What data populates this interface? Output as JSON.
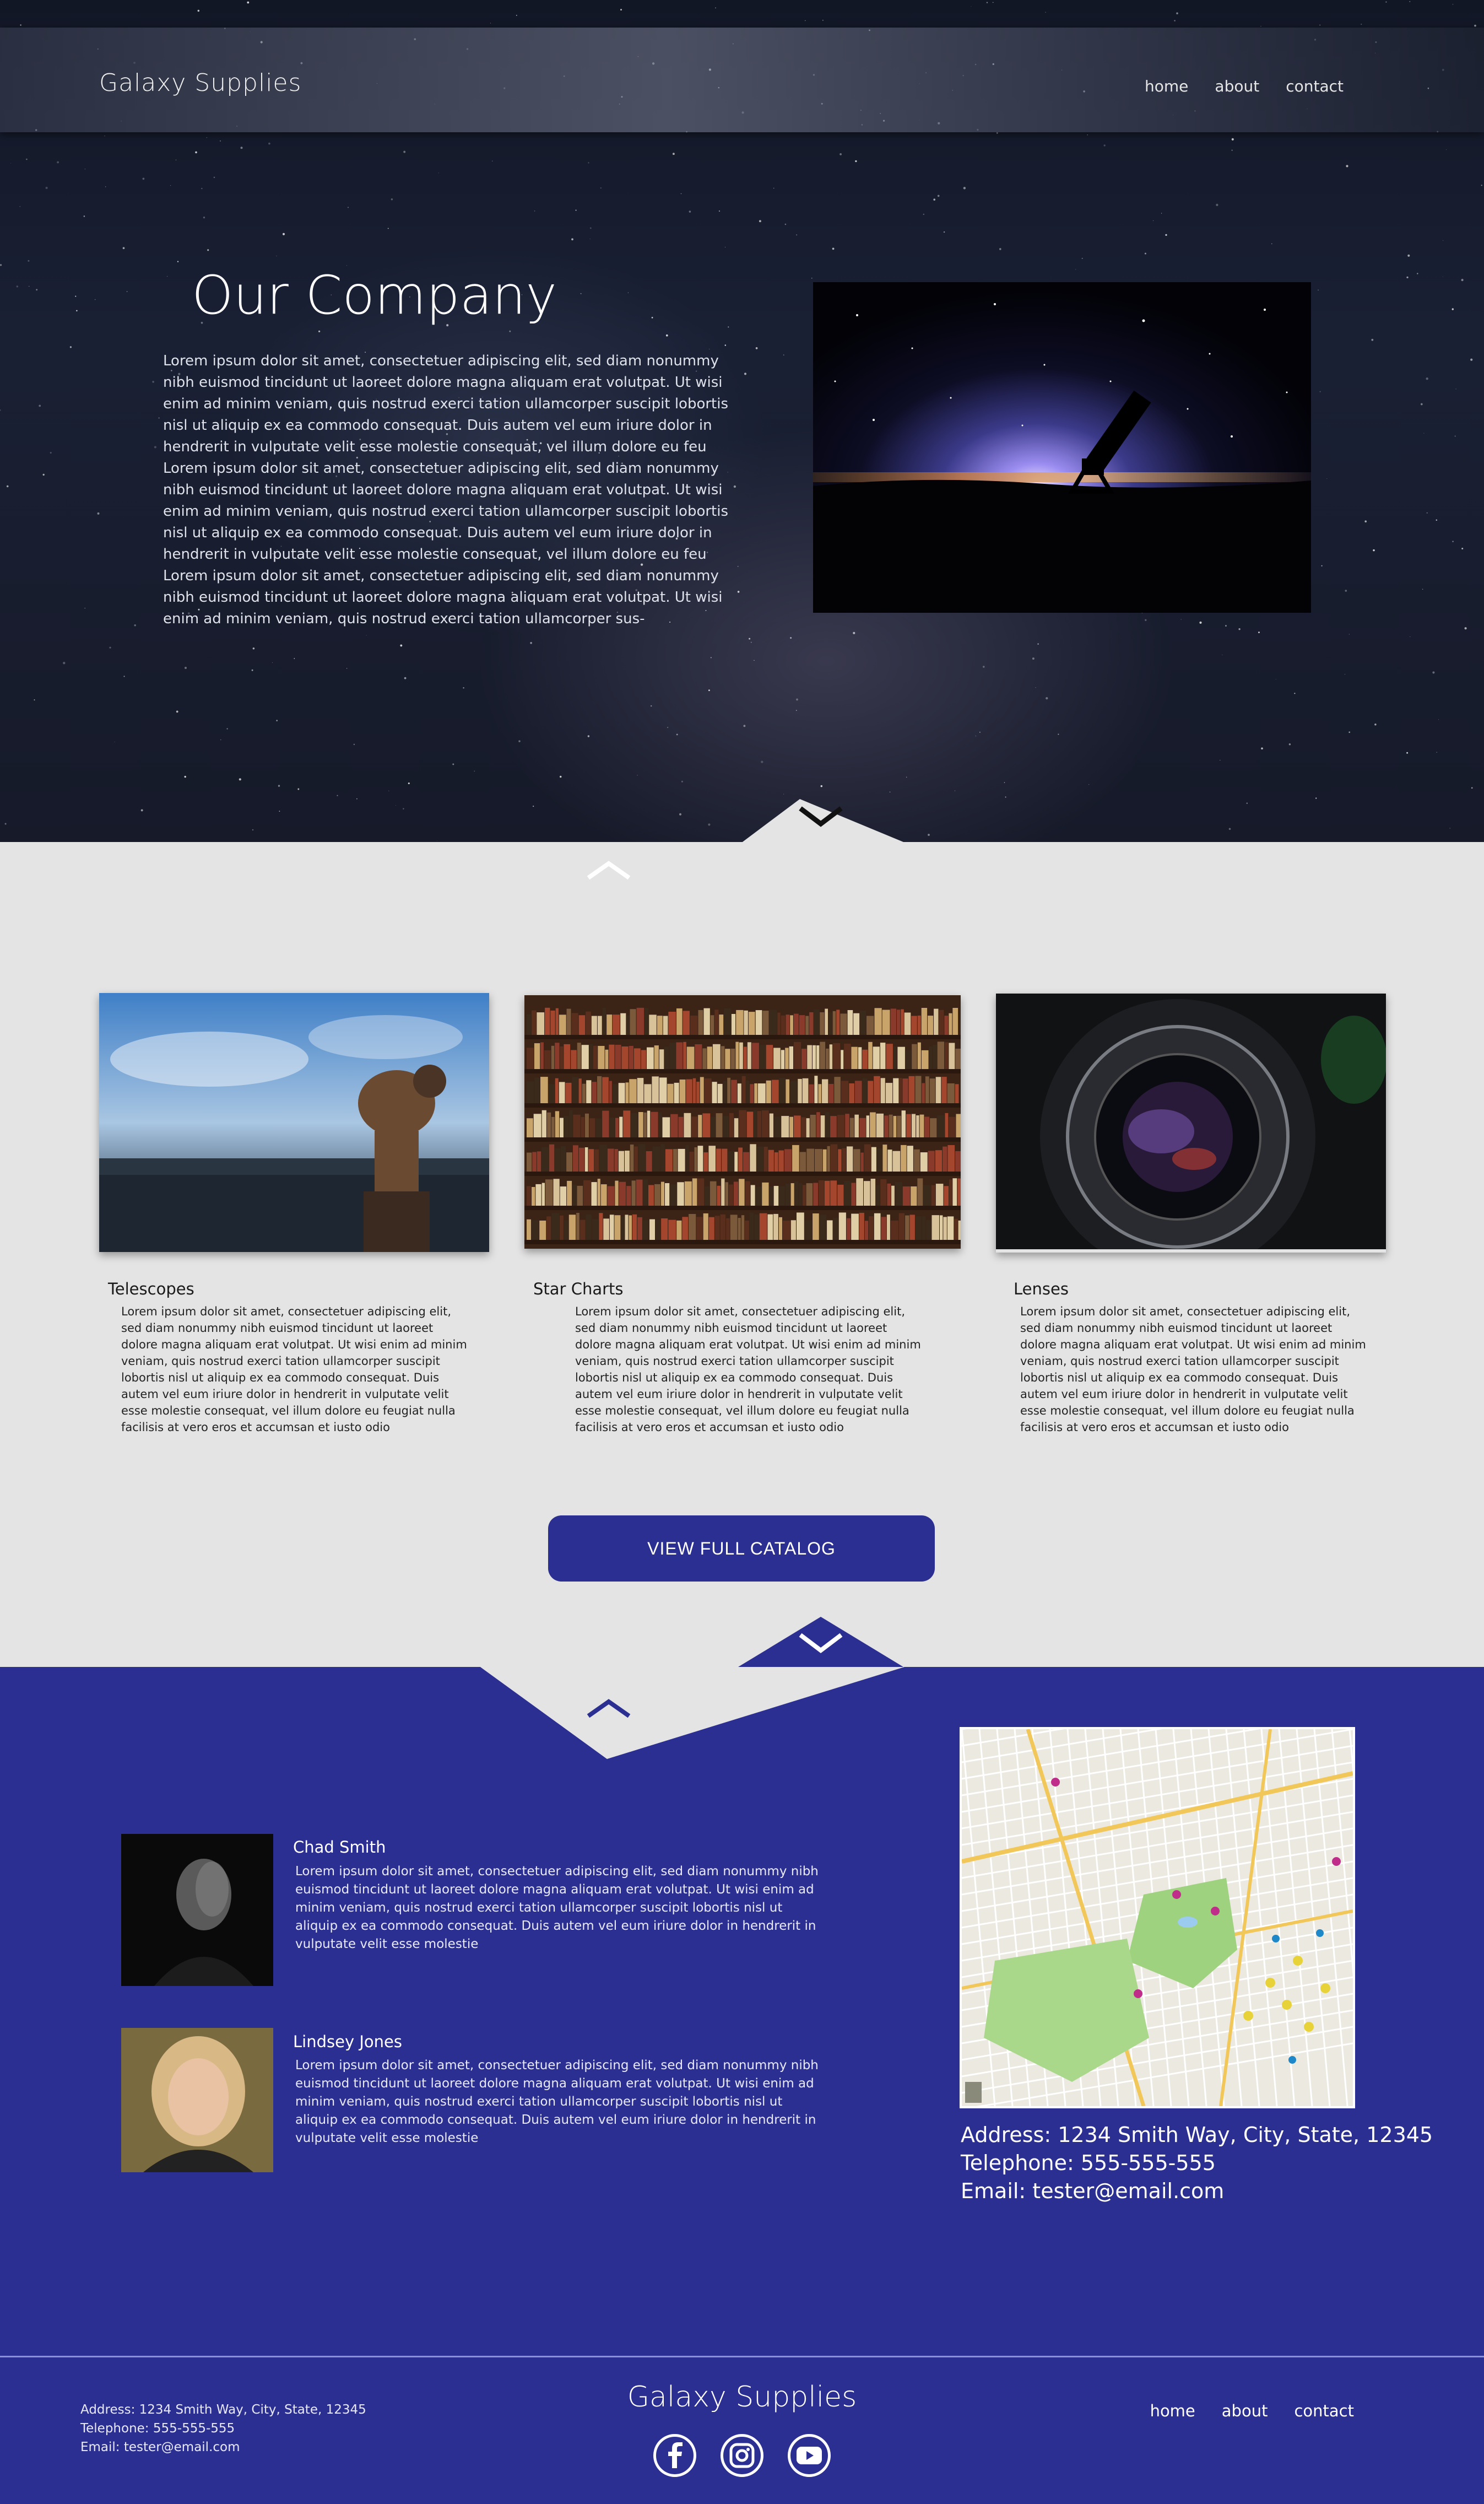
{
  "header": {
    "brand": "Galaxy Supplies",
    "nav": [
      "home",
      "about",
      "contact"
    ]
  },
  "hero": {
    "title": "Our Company",
    "text": "Lorem ipsum dolor sit amet, consectetuer adipiscing elit, sed diam nonummy nibh euismod tincidunt ut laoreet dolore magna aliquam erat volutpat. Ut wisi enim ad minim veniam, quis nostrud exerci tation ullamcorper suscipit lobortis nisl ut aliquip ex ea commodo consequat. Duis autem vel eum iriure dolor in hendrerit in vulputate velit esse molestie consequat, vel illum dolore eu feu Lorem ipsum dolor sit amet, consectetuer adipiscing elit, sed diam nonummy nibh euismod tincidunt ut laoreet dolore magna aliquam erat volutpat. Ut wisi enim ad minim veniam, quis nostrud exerci tation ullamcorper suscipit lobortis nisl ut aliquip ex ea commodo consequat. Duis autem vel eum iriure dolor in hendrerit in vulputate velit esse molestie consequat, vel illum dolore eu feu Lorem ipsum dolor sit amet, consectetuer adipiscing elit, sed diam nonummy nibh euismod tincidunt ut laoreet dolore magna aliquam erat volutpat. Ut wisi enim ad minim veniam, quis nostrud exerci tation ullamcorper sus-"
  },
  "products": [
    {
      "title": "Telescopes",
      "text": "Lorem ipsum dolor sit amet, consectetuer adipiscing elit, sed diam nonummy nibh euismod tincidunt ut laoreet dolore magna aliquam erat volutpat. Ut wisi enim ad minim veniam, quis nostrud exerci tation ullamcorper suscipit lobortis nisl ut aliquip ex ea commodo consequat. Duis autem vel eum iriure dolor in hendrerit in vulputate velit esse molestie consequat, vel illum dolore eu feugiat nulla facilisis at vero eros et accumsan et iusto odio"
    },
    {
      "title": "Star Charts",
      "text": "Lorem ipsum dolor sit amet, consectetuer adipiscing elit, sed diam nonummy nibh euismod tincidunt ut laoreet dolore magna aliquam erat volutpat. Ut wisi enim ad minim veniam, quis nostrud exerci tation ullamcorper suscipit lobortis nisl ut aliquip ex ea commodo consequat. Duis autem vel eum iriure dolor in hendrerit in vulputate velit esse molestie consequat, vel illum dolore eu feugiat nulla facilisis at vero eros et accumsan et iusto odio"
    },
    {
      "title": "Lenses",
      "text": "Lorem ipsum dolor sit amet, consectetuer adipiscing elit, sed diam nonummy nibh euismod tincidunt ut laoreet dolore magna aliquam erat volutpat. Ut wisi enim ad minim veniam, quis nostrud exerci tation ullamcorper suscipit lobortis nisl ut aliquip ex ea commodo consequat. Duis autem vel eum iriure dolor in hendrerit in vulputate velit esse molestie consequat, vel illum dolore eu feugiat nulla facilisis at vero eros et accumsan et iusto odio"
    }
  ],
  "catalog_button": "VIEW FULL CATALOG",
  "team": [
    {
      "name": "Chad Smith",
      "text": "Lorem ipsum dolor sit amet, consectetuer adipiscing elit, sed diam nonummy nibh euismod tincidunt ut laoreet dolore magna aliquam erat volutpat. Ut wisi enim ad minim veniam, quis nostrud exerci tation ullamcorper suscipit lobortis nisl ut aliquip ex ea commodo consequat. Duis autem vel eum iriure dolor in hendrerit in vulputate velit esse molestie"
    },
    {
      "name": "Lindsey Jones",
      "text": "Lorem ipsum dolor sit amet, consectetuer adipiscing elit, sed diam nonummy nibh euismod tincidunt ut laoreet dolore magna aliquam erat volutpat. Ut wisi enim ad minim veniam, quis nostrud exerci tation ullamcorper suscipit lobortis nisl ut aliquip ex ea commodo consequat. Duis autem vel eum iriure dolor in hendrerit in vulputate velit esse molestie"
    }
  ],
  "contact": {
    "address": "Address: 1234 Smith Way, City, State, 12345",
    "telephone": "Telephone: 555-555-555",
    "email": "Email: tester@email.com"
  },
  "footer": {
    "brand": "Galaxy Supplies",
    "address": "Address: 1234 Smith Way, City, State, 12345",
    "telephone": "Telephone: 555-555-555",
    "email": "Email: tester@email.com",
    "nav": [
      "home",
      "about",
      "contact"
    ],
    "social_icons": [
      "facebook-icon",
      "instagram-icon",
      "youtube-icon"
    ]
  },
  "colors": {
    "accent": "#2c2f92",
    "light_bg": "#e4e4e4",
    "hero_bg": "#161a29"
  }
}
